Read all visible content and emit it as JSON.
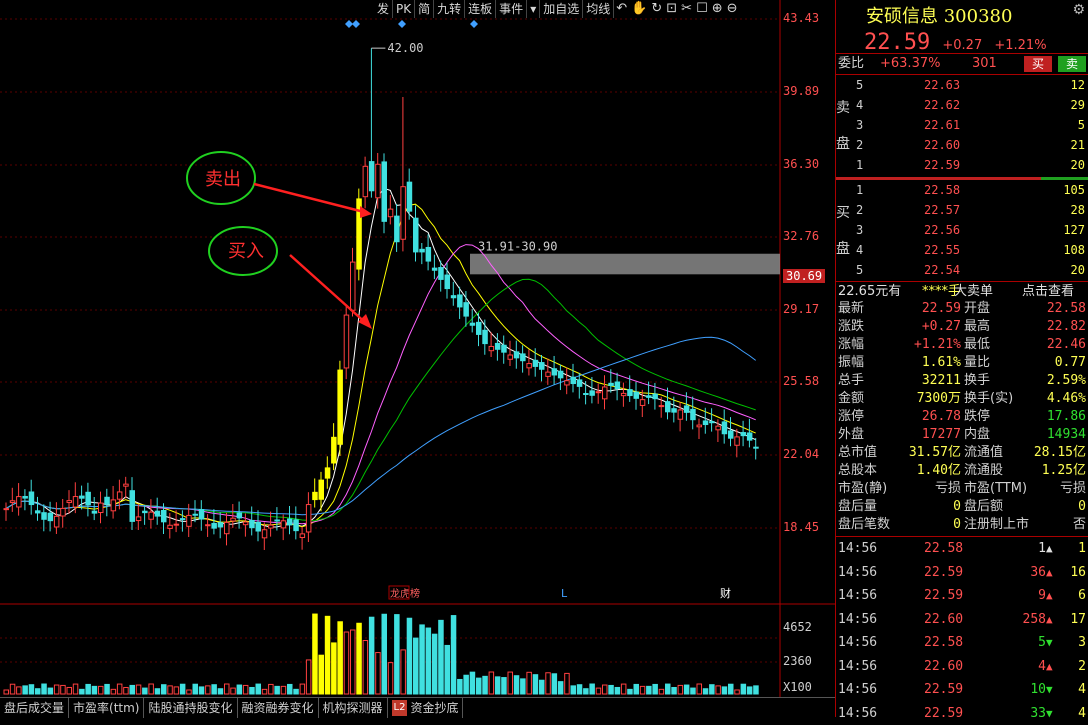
{
  "toolbar": [
    {
      "label": "发",
      "name": "tb-fa"
    },
    {
      "label": "PK",
      "name": "tb-pk"
    },
    {
      "label": "简",
      "name": "tb-jian"
    },
    {
      "label": "九转",
      "name": "tb-jiuzhuan"
    },
    {
      "label": "连板",
      "name": "tb-lianban"
    },
    {
      "label": "事件",
      "name": "tb-shijian"
    },
    {
      "label": "加自选",
      "name": "tb-add-watch"
    },
    {
      "label": "均线",
      "name": "tb-ma"
    }
  ],
  "price_axis": [
    "43.43",
    "39.89",
    "36.30",
    "32.76",
    "30.69",
    "29.17",
    "25.58",
    "22.04",
    "18.45"
  ],
  "volume_axis": [
    "4652",
    "2360",
    "X100"
  ],
  "annotations": {
    "high_label": "42.00",
    "band_label": "31.91-30.90",
    "sell_label": "卖出",
    "buy_label": "买入",
    "marker_1": "龙虎榜",
    "marker_2": "L",
    "marker_3": "财"
  },
  "tabs": [
    "盘后成交量",
    "市盈率(ttm)",
    "陆股通持股变化",
    "融资融券变化",
    "机构探测器",
    "资金抄底"
  ],
  "tab_l2_badge": "L2",
  "stock": {
    "name": "安硕信息",
    "code": "300380",
    "price": "22.59",
    "change": "+0.27",
    "change_pct": "+1.21%"
  },
  "weibi": {
    "label": "委比",
    "pct": "+63.37%",
    "num": "301",
    "buy": "买",
    "sell": "卖"
  },
  "sell_side_label": [
    "卖",
    "盘"
  ],
  "buy_side_label": [
    "买",
    "盘"
  ],
  "asks": [
    {
      "lv": "5",
      "price": "22.63",
      "vol": "12"
    },
    {
      "lv": "4",
      "price": "22.62",
      "vol": "29"
    },
    {
      "lv": "3",
      "price": "22.61",
      "vol": "5"
    },
    {
      "lv": "2",
      "price": "22.60",
      "vol": "21"
    },
    {
      "lv": "1",
      "price": "22.59",
      "vol": "20"
    }
  ],
  "bids": [
    {
      "lv": "1",
      "price": "22.58",
      "vol": "105"
    },
    {
      "lv": "2",
      "price": "22.57",
      "vol": "28"
    },
    {
      "lv": "3",
      "price": "22.56",
      "vol": "127"
    },
    {
      "lv": "4",
      "price": "22.55",
      "vol": "108"
    },
    {
      "lv": "5",
      "price": "22.54",
      "vol": "20"
    }
  ],
  "ticker": {
    "price": "22.65元有",
    "hidden": "****手",
    "order": "大卖单",
    "link": "点击查看"
  },
  "stats": [
    {
      "k1": "最新",
      "v1": "22.59",
      "c1": "red",
      "k2": "开盘",
      "v2": "22.58",
      "c2": "red"
    },
    {
      "k1": "涨跌",
      "v1": "+0.27",
      "c1": "red",
      "k2": "最高",
      "v2": "22.82",
      "c2": "red"
    },
    {
      "k1": "涨幅",
      "v1": "+1.21%",
      "c1": "red",
      "k2": "最低",
      "v2": "22.46",
      "c2": "red"
    },
    {
      "k1": "振幅",
      "v1": "1.61%",
      "c1": "yellow",
      "k2": "量比",
      "v2": "0.77",
      "c2": "yellow"
    },
    {
      "k1": "总手",
      "v1": "32211",
      "c1": "yellow",
      "k2": "换手",
      "v2": "2.59%",
      "c2": "yellow"
    },
    {
      "k1": "金额",
      "v1": "7300万",
      "c1": "yellow",
      "k2": "换手(实)",
      "v2": "4.46%",
      "c2": "yellow"
    },
    {
      "k1": "涨停",
      "v1": "26.78",
      "c1": "red",
      "k2": "跌停",
      "v2": "17.86",
      "c2": "green"
    },
    {
      "k1": "外盘",
      "v1": "17277",
      "c1": "red",
      "k2": "内盘",
      "v2": "14934",
      "c2": "green"
    },
    {
      "k1": "总市值",
      "v1": "31.57亿",
      "c1": "yellow",
      "k2": "流通值",
      "v2": "28.15亿",
      "c2": "yellow"
    },
    {
      "k1": "总股本",
      "v1": "1.40亿",
      "c1": "yellow",
      "k2": "流通股",
      "v2": "1.25亿",
      "c2": "yellow"
    },
    {
      "k1": "市盈(静)",
      "v1": "亏损",
      "c1": "grey",
      "k2": "市盈(TTM)",
      "v2": "亏损",
      "c2": "grey"
    },
    {
      "k1": "盘后量",
      "v1": "0",
      "c1": "yellow",
      "k2": "盘后额",
      "v2": "0",
      "c2": "yellow"
    },
    {
      "k1": "盘后笔数",
      "v1": "0",
      "c1": "yellow",
      "k2": "注册制上市",
      "v2": "否",
      "c2": "grey"
    }
  ],
  "trades": [
    {
      "t": "14:56",
      "p": "22.58",
      "pc": "red",
      "v": "1",
      "vc": "white",
      "dir": "up",
      "n": "1"
    },
    {
      "t": "14:56",
      "p": "22.59",
      "pc": "red",
      "v": "36",
      "vc": "red",
      "dir": "up",
      "n": "16"
    },
    {
      "t": "14:56",
      "p": "22.59",
      "pc": "red",
      "v": "9",
      "vc": "red",
      "dir": "up",
      "n": "6"
    },
    {
      "t": "14:56",
      "p": "22.60",
      "pc": "red",
      "v": "258",
      "vc": "red",
      "dir": "up",
      "n": "17"
    },
    {
      "t": "14:56",
      "p": "22.58",
      "pc": "red",
      "v": "5",
      "vc": "green",
      "dir": "down",
      "n": "3"
    },
    {
      "t": "14:56",
      "p": "22.60",
      "pc": "red",
      "v": "4",
      "vc": "red",
      "dir": "up",
      "n": "2"
    },
    {
      "t": "14:56",
      "p": "22.59",
      "pc": "red",
      "v": "10",
      "vc": "green",
      "dir": "down",
      "n": "4"
    },
    {
      "t": "14:56",
      "p": "22.59",
      "pc": "red",
      "v": "33",
      "vc": "green",
      "dir": "down",
      "n": "4"
    }
  ],
  "colors": {
    "up": "#ff4040",
    "down": "#40e0e0",
    "limit": "#ffff00",
    "ma5": "#ffffff",
    "ma10": "#ffff00",
    "ma20": "#ff60ff",
    "ma30": "#00c000",
    "ma60": "#40a0ff"
  }
}
